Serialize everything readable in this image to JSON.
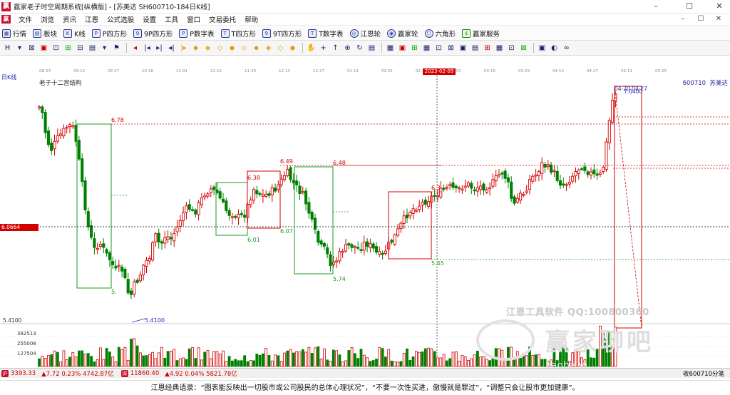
{
  "window": {
    "title": "赢家老子时空周期系统[纵横版] - [苏美达  SH600710-184日K线]",
    "minimize": "–",
    "maximize": "☐",
    "close": "✕"
  },
  "menu": [
    "文件",
    "浏览",
    "资讯",
    "江恩",
    "公式选股",
    "设置",
    "工具",
    "窗口",
    "交易委托",
    "帮助"
  ],
  "mdi_controls": [
    "–",
    "☐",
    "✕"
  ],
  "toolbar1": [
    {
      "icon": "grid-icon",
      "label": "行情"
    },
    {
      "icon": "blocks-icon",
      "label": "板块"
    },
    {
      "icon": "kline-icon",
      "label": "K线"
    },
    {
      "icon": "p-box-icon",
      "label": "P四方形"
    },
    {
      "icon": "9p-box-icon",
      "label": "9P四方形"
    },
    {
      "icon": "p-table-icon",
      "label": "P数字表"
    },
    {
      "icon": "t-box-icon",
      "label": "T四方形"
    },
    {
      "icon": "9t-box-icon",
      "label": "9T四方形"
    },
    {
      "icon": "t-table-icon",
      "label": "T数字表"
    },
    {
      "icon": "gann-wheel-icon",
      "label": "江恩轮"
    },
    {
      "icon": "winner-wheel-icon",
      "label": "赢家轮"
    },
    {
      "icon": "hexagon-icon",
      "label": "六角形"
    },
    {
      "icon": "dollar-icon",
      "label": "赢家服务"
    }
  ],
  "toolbar2_icons": [
    "H",
    "▾",
    "⊠",
    "▣",
    "⊡",
    "⊞",
    "⊟",
    "▤",
    "▾",
    "⚑",
    "◂",
    "|◂",
    "▸|",
    "◂|",
    "|▸",
    "⬥",
    "◈",
    "◇",
    "◆",
    "⬦",
    "⬥",
    "◈",
    "◇",
    "◆",
    "✋",
    "+",
    "↑",
    "⊕",
    "↻",
    "▤",
    "▦",
    "▣",
    "⊞",
    "▦",
    "⊡",
    "⊠",
    "▣",
    "▤",
    "⊞",
    "▦",
    "⊡",
    "⊠",
    "▣",
    "◐",
    "∞"
  ],
  "chart": {
    "period_label": "日K线",
    "indicator_name": "老子十二宫结构",
    "stock_code": "600710",
    "stock_name": "苏美达",
    "dates": [
      "08-23",
      "09-13",
      "09-27",
      "10-18",
      "11-01",
      "11-15",
      "11-29",
      "12-13",
      "12-27",
      "01-11",
      "02-01",
      "02-15",
      "03-01",
      "03-15",
      "03-29",
      "04-13",
      "04-27",
      "05-11",
      "05-25"
    ],
    "selected_date": "2023-02-09",
    "current_price_label": "6.0664",
    "crosshair_label": "5.4100",
    "high_label": "7.0400",
    "high_label2": "04-20 04-27",
    "axis_low": "5.4100",
    "volume_ticks": [
      "382513",
      "255008",
      "127504"
    ],
    "price_levels": [
      "6.78",
      "6.38",
      "6.49",
      "6.48",
      "6.01",
      "6.07",
      "5.74",
      "5.45",
      "5.4100",
      "6.3"
    ]
  },
  "chart_data": {
    "type": "candlestick",
    "title": "老子十二宫结构",
    "series": [
      {
        "name": "苏美达 600710",
        "values": []
      }
    ],
    "ylim": [
      5.41,
      7.04
    ],
    "annotations": [
      "6.78",
      "6.38",
      "6.49",
      "6.48",
      "6.01",
      "6.07",
      "5.74",
      "5.45",
      "5.4100"
    ]
  },
  "status": {
    "sh_index": "3393.33",
    "sh_change": "▲7.72 0.23% 4742.87亿",
    "sz_index": "11860.40",
    "sz_change": "▲4.92 0.04% 5821.78亿",
    "right_text": "收600710分笔"
  },
  "watermark": {
    "line1": "江恩工具软件 QQ:100800360",
    "line2": "赢家聊吧",
    "line3": "liaoba.yi..."
  },
  "quote_text": "江恩经典语录：“图表能反映出一切股市或公司股民的总体心理状况”，“不要一次性买进，傲慢就是罪过”，“调整只会让股市更加健康”。"
}
